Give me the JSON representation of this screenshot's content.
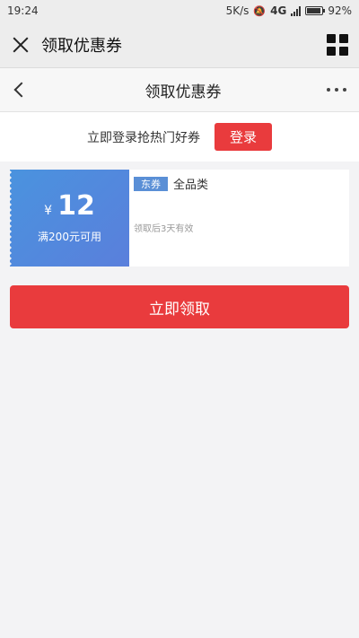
{
  "status_bar": {
    "time": "19:24",
    "network_speed": "5K/s",
    "network_type": "4G",
    "battery": "92%",
    "battery_level": 0.92
  },
  "wechat_bar": {
    "title": "领取优惠券",
    "close_icon": "close-icon",
    "menu_icon": "grid-icon"
  },
  "nav": {
    "title": "领取优惠券",
    "back_icon": "chevron-left-icon",
    "more_icon": "more-icon"
  },
  "login_prompt": {
    "text": "立即登录抢热门好券",
    "button_label": "登录"
  },
  "coupon": {
    "currency": "¥",
    "amount": "12",
    "condition": "满200元可用",
    "tag": "东券",
    "scope": "全品类",
    "validity": "领取后3天有效"
  },
  "claim_button": {
    "label": "立即领取"
  },
  "colors": {
    "accent_red": "#e93b3d",
    "coupon_blue": "#4a93de",
    "tag_blue": "#5a8fd6"
  }
}
